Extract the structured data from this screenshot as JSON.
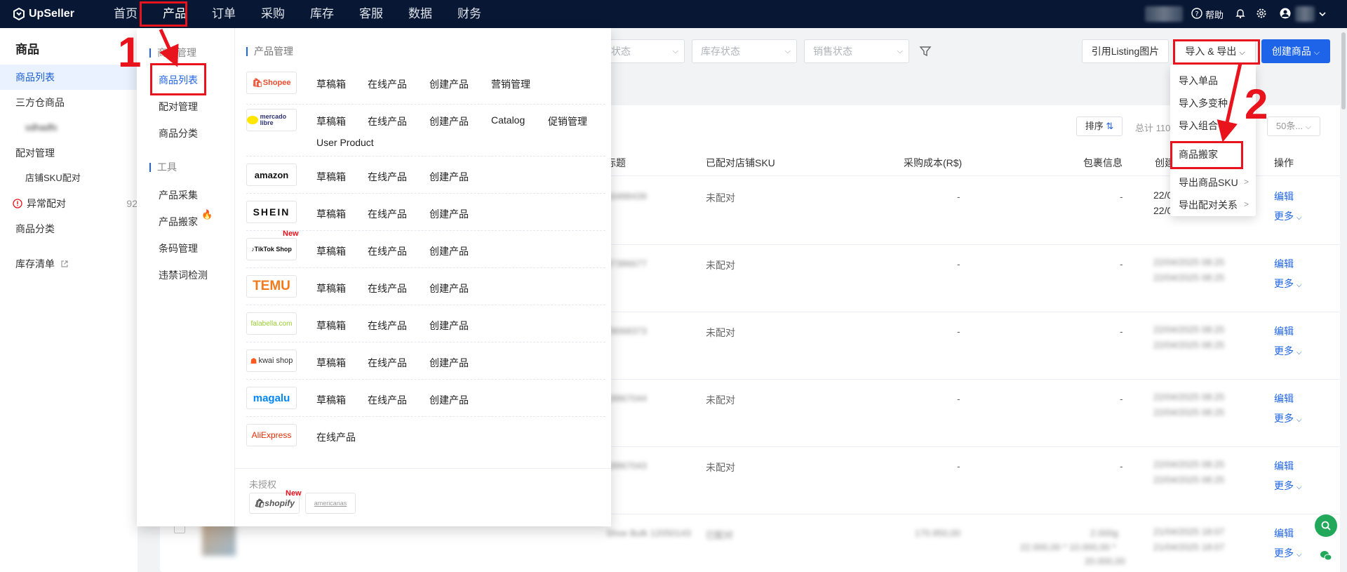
{
  "brand": "UpSeller",
  "nav": [
    "首页",
    "产品",
    "订单",
    "采购",
    "库存",
    "客服",
    "数据",
    "财务"
  ],
  "topbar": {
    "help": "帮助"
  },
  "sidebar": {
    "title": "商品",
    "items": [
      {
        "label": "商品列表",
        "active": true
      },
      {
        "label": "三方仓商品"
      },
      {
        "label": "sdhadfs",
        "sub": true,
        "blurred": true
      },
      {
        "label": "配对管理"
      },
      {
        "label": "店铺SKU配对",
        "sub": true
      },
      {
        "label": "异常配对",
        "count": "92",
        "warn": true
      },
      {
        "label": "商品分类"
      },
      {
        "label": "库存清单",
        "external": true
      }
    ]
  },
  "filters": [
    "状态",
    "库存状态",
    "销售状态"
  ],
  "toolbar": {
    "listing": "引用Listing图片",
    "import_export": "导入 & 导出",
    "create": "创建商品",
    "sort": "排序",
    "total": "总计 110",
    "page_size": "50条..."
  },
  "columns": [
    "标题",
    "已配对店铺SKU",
    "采购成本(R$)",
    "包裹信息",
    "创建",
    "操作"
  ],
  "rows": [
    {
      "id": "16488439",
      "pair": "未配对",
      "cost": "-",
      "pkg": "-",
      "created": "22/0",
      "created2": "22/0",
      "edit": "编辑",
      "more": "更多"
    },
    {
      "id": "87386677",
      "pair": "未配对",
      "cost": "-",
      "pkg": "-",
      "created": "22/04/2025 08:25",
      "created2": "22/04/2025 08:25",
      "edit": "编辑",
      "more": "更多"
    },
    {
      "id": "29068373",
      "pair": "未配对",
      "cost": "-",
      "pkg": "-",
      "created": "22/04/2025 08:25",
      "created2": "22/04/2025 08:25",
      "edit": "编辑",
      "more": "更多"
    },
    {
      "id": "18867044",
      "pair": "未配对",
      "cost": "-",
      "pkg": "-",
      "created": "22/04/2025 08:25",
      "created2": "22/04/2025 08:25",
      "edit": "编辑",
      "more": "更多"
    },
    {
      "id": "18867043",
      "pair": "未配对",
      "cost": "-",
      "pkg": "-",
      "created": "22/04/2025 08:25",
      "created2": "22/04/2025 08:25",
      "edit": "编辑",
      "more": "更多"
    },
    {
      "id": "Shoe Bulk 12050143",
      "pair": "已配对",
      "cost": "170.950,00",
      "pkg": "2.000g",
      "pkg2": "22.000,00 * 10.000,00 *",
      "pkg3": "20.000,00",
      "created": "21/04/2025 18:07",
      "created2": "21/04/2025 18:07",
      "edit": "编辑",
      "more": "更多"
    }
  ],
  "mega": {
    "left_header1": "商品管理",
    "left_items1": [
      "商品列表",
      "配对管理",
      "商品分类"
    ],
    "left_header2": "工具",
    "left_items2": [
      "产品采集",
      "产品搬家",
      "条码管理",
      "违禁词检测"
    ],
    "right_header": "产品管理",
    "platforms": [
      {
        "logo": "Shopee",
        "links": [
          "草稿箱",
          "在线产品",
          "创建产品",
          "营销管理"
        ]
      },
      {
        "logo": "mercado libre",
        "links": [
          "草稿箱",
          "在线产品",
          "创建产品",
          "Catalog",
          "促销管理",
          "User Product"
        ]
      },
      {
        "logo": "amazon",
        "links": [
          "草稿箱",
          "在线产品",
          "创建产品"
        ]
      },
      {
        "logo": "SHEIN",
        "links": [
          "草稿箱",
          "在线产品",
          "创建产品"
        ]
      },
      {
        "logo": "TikTok Shop",
        "new": "New",
        "links": [
          "草稿箱",
          "在线产品",
          "创建产品"
        ]
      },
      {
        "logo": "TEMU",
        "links": [
          "草稿箱",
          "在线产品",
          "创建产品"
        ]
      },
      {
        "logo": "falabella.com",
        "links": [
          "草稿箱",
          "在线产品",
          "创建产品"
        ]
      },
      {
        "logo": "kwai shop",
        "links": [
          "草稿箱",
          "在线产品",
          "创建产品"
        ]
      },
      {
        "logo": "magalu",
        "links": [
          "草稿箱",
          "在线产品",
          "创建产品"
        ]
      },
      {
        "logo": "AliExpress",
        "links": [
          "在线产品"
        ]
      }
    ],
    "unauth_header": "未授权",
    "unauth": [
      {
        "logo": "shopify",
        "new": "New"
      },
      {
        "logo": "americanas"
      }
    ]
  },
  "dropdown": [
    {
      "label": "导入单品"
    },
    {
      "label": "导入多变种"
    },
    {
      "label": "导入组合"
    },
    {
      "label": "商品搬家"
    },
    {
      "label": "导出商品SKU",
      "chev": ">"
    },
    {
      "label": "导出配对关系",
      "chev": ">"
    }
  ],
  "annotations": [
    "1",
    "2"
  ],
  "colors": {
    "nav_bg": "#081734",
    "primary": "#1e64e8",
    "annotation_red": "#e8131d"
  }
}
